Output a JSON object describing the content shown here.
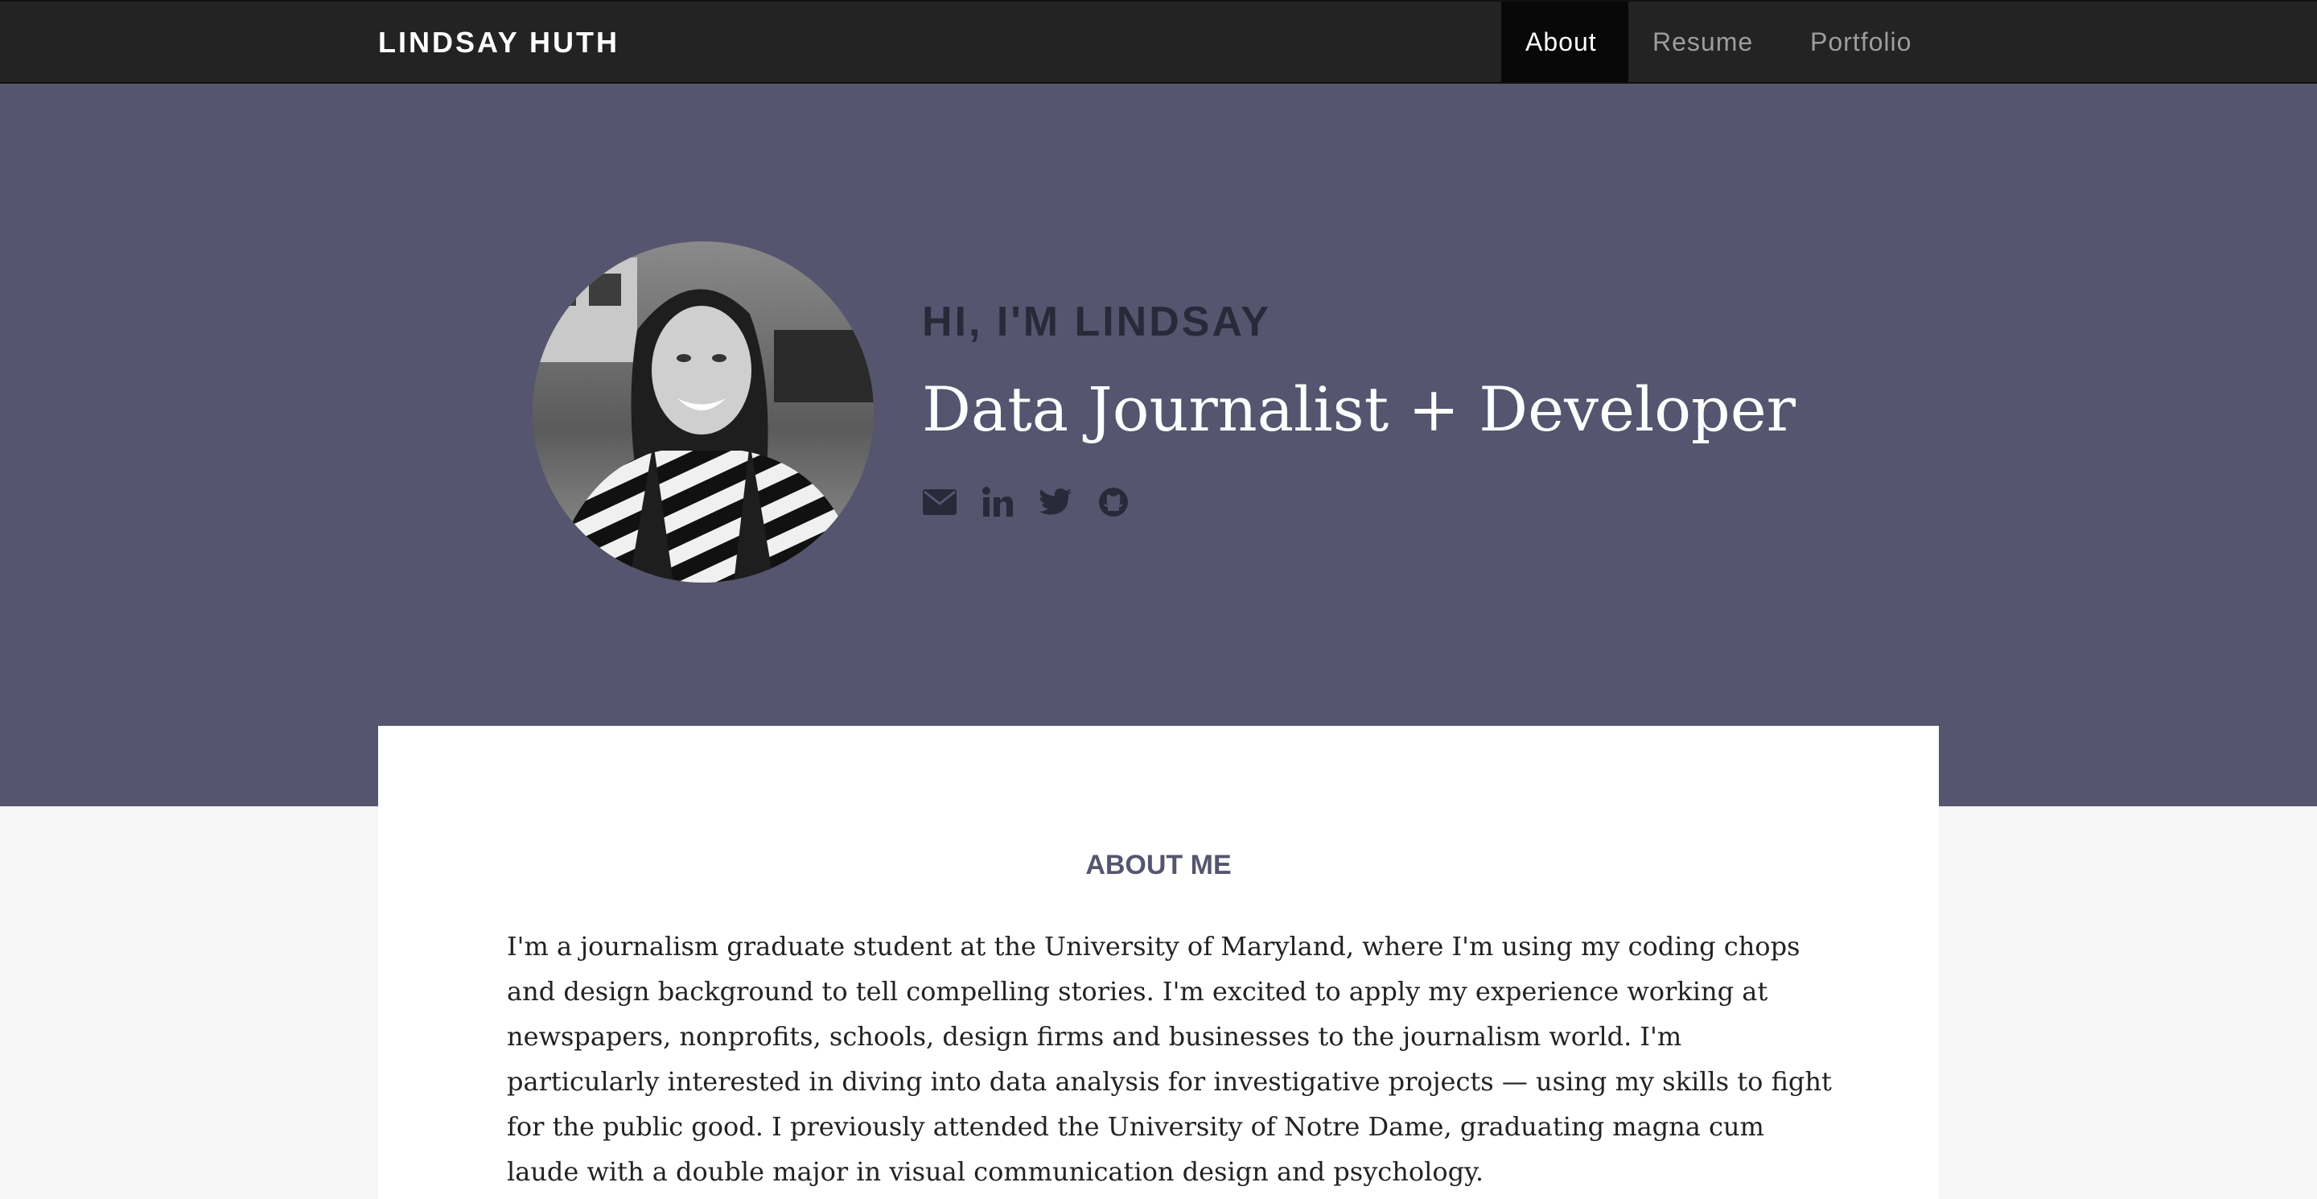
{
  "navbar": {
    "brand": "LINDSAY HUTH",
    "items": [
      {
        "label": "About",
        "active": true
      },
      {
        "label": "Resume",
        "active": false
      },
      {
        "label": "Portfolio",
        "active": false
      }
    ]
  },
  "hero": {
    "greeting": "HI, I'M LINDSAY",
    "tagline": "Data Journalist + Developer",
    "socials": [
      "envelope-icon",
      "linkedin-icon",
      "twitter-icon",
      "github-icon"
    ]
  },
  "about": {
    "heading": "ABOUT ME",
    "body": "I'm a journalism graduate student at the University of Maryland, where I'm using my coding chops and design background to tell compelling stories. I'm excited to apply my experience working at newspapers, nonprofits, schools, design firms and businesses to the journalism world. I'm particularly interested in diving into data analysis for investigative projects — using my skills to fight for the public good. I previously attended the University of Notre Dame, graduating magna cum laude with a double major in visual communication design and psychology."
  },
  "colors": {
    "navbar": "#232323",
    "hero": "#55556f",
    "greeting": "#29293a",
    "icon": "#29293a",
    "heading": "#55556f",
    "page": "#f6f6f6"
  }
}
